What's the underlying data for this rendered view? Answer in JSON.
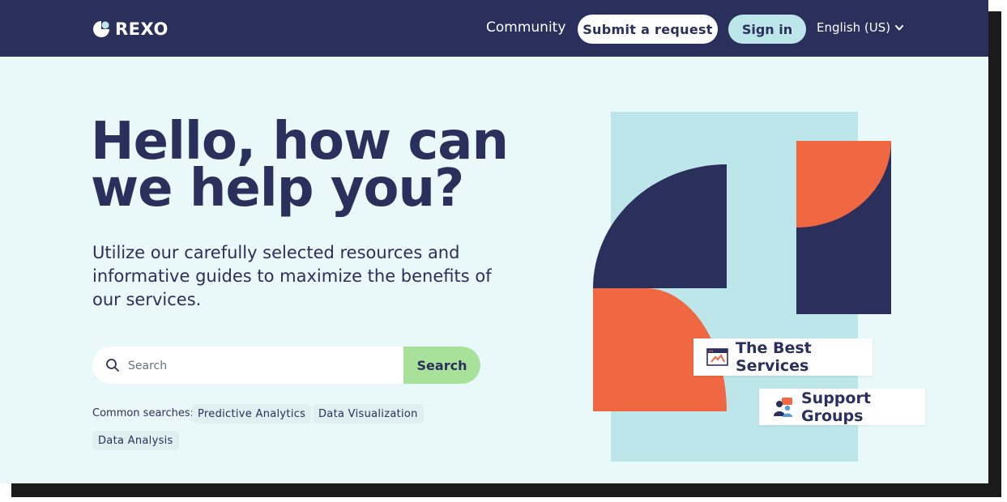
{
  "header": {
    "logo_text": "rexo",
    "nav": {
      "community": "Community"
    },
    "submit_request": "Submit a request",
    "sign_in": "Sign in",
    "language": "English (US)"
  },
  "hero": {
    "title": "Hello, how can we help you?",
    "subtitle": "Utilize our carefully selected resources and informative guides to maximize the benefits of our services."
  },
  "search": {
    "placeholder": "Search",
    "button_label": "Search",
    "icon": "search-icon"
  },
  "common_searches": {
    "label": "Common searches:",
    "tags": [
      "Predictive Analytics",
      "Data Visualization",
      "Data Analysis"
    ]
  },
  "illustration": {
    "cards": [
      {
        "label": "The Best Services",
        "icon": "browser-window-icon"
      },
      {
        "label": "Support Groups",
        "icon": "people-chat-icon"
      }
    ]
  },
  "colors": {
    "navy": "#2b2f5c",
    "orange": "#ef6842",
    "light_blue": "#bde6ea",
    "background": "#e9f8f8",
    "search_green": "#a8e29a"
  }
}
